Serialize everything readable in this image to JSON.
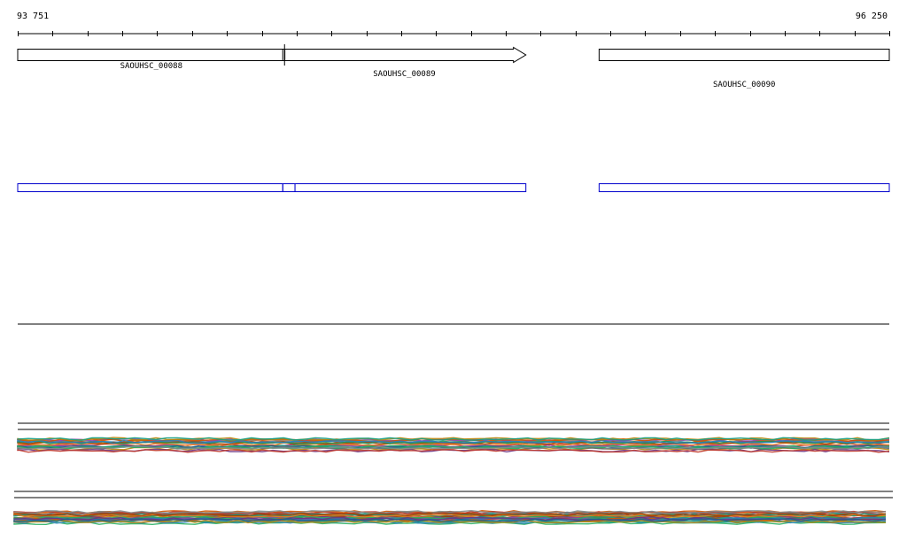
{
  "coordinates": {
    "start_label": "93 751",
    "end_label": "96 250",
    "start": 93751,
    "end": 96250
  },
  "genes": [
    {
      "id": "SAOUHSC_00088",
      "label": "SAOUHSC_00088",
      "start": 93751,
      "end": 94517,
      "strand": "+",
      "arrow": false
    },
    {
      "id": "SAOUHSC_00089",
      "label": "SAOUHSC_00089",
      "start": 94511,
      "end": 95208,
      "strand": "+",
      "arrow": true
    },
    {
      "id": "SAOUHSC_00090",
      "label": "SAOUHSC_00090",
      "start": 95418,
      "end": 96250,
      "strand": "+",
      "arrow": false
    }
  ],
  "cds_track": [
    {
      "gene": "SAOUHSC_00088",
      "start": 93751,
      "end": 94511
    },
    {
      "gene": "SAOUHSC_00088-overlap",
      "start": 94511,
      "end": 94546
    },
    {
      "gene": "SAOUHSC_00089",
      "start": 94546,
      "end": 95208
    },
    {
      "gene": "SAOUHSC_00090",
      "start": 95418,
      "end": 96250
    }
  ],
  "colors": {
    "gene_outline": "#000000",
    "cds_outline": "#0000cc",
    "track_line": "#000000",
    "coverage_palette": [
      "#c0392b",
      "#8e44ad",
      "#27ae60",
      "#d35400",
      "#2980b9",
      "#7f8c8d",
      "#b8860b",
      "#16a085",
      "#e67e22",
      "#6c3483",
      "#1f618d",
      "#a04000",
      "#5d6d7e",
      "#229954"
    ]
  }
}
